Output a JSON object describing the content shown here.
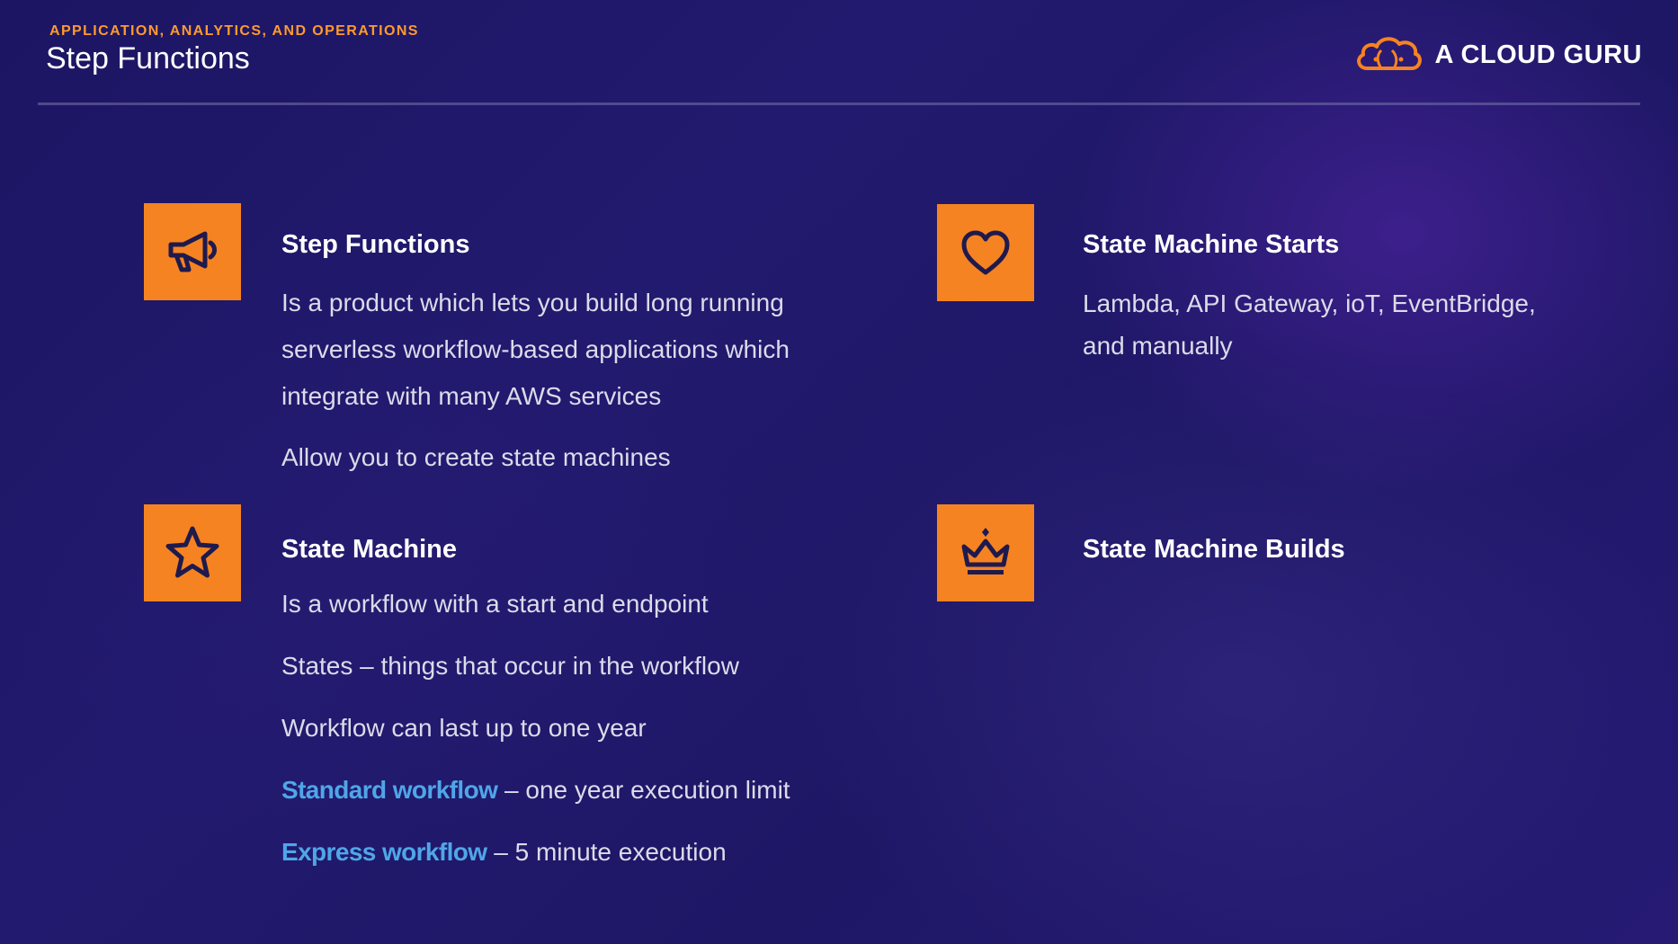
{
  "header": {
    "eyebrow": "APPLICATION, ANALYTICS, AND OPERATIONS",
    "title": "Step Functions",
    "brand_name": "A CLOUD GURU",
    "brand_icon": "cloud-logo-icon"
  },
  "colors": {
    "accent_orange": "#f68321",
    "eyebrow_orange": "#ff9a2e",
    "link_blue": "#4fa6e8",
    "background": "#1e1766"
  },
  "cards": {
    "step_functions": {
      "icon": "megaphone-icon",
      "heading": "Step Functions",
      "lines": [
        "Is a product which lets you build long running",
        "serverless workflow-based applications which",
        "integrate with many AWS services"
      ],
      "extra": "Allow you to create state machines"
    },
    "state_machine_starts": {
      "icon": "heart-icon",
      "heading": "State Machine Starts",
      "lines": [
        "Lambda, API Gateway, ioT, EventBridge,",
        "and manually"
      ]
    },
    "state_machine": {
      "icon": "star-icon",
      "heading": "State Machine",
      "items": [
        "Is a workflow with a start and endpoint",
        "States – things that occur in the workflow",
        "Workflow can last up to one year"
      ],
      "standard": {
        "label": "Standard workflow",
        "text": " – one year execution limit"
      },
      "express": {
        "label": "Express workflow",
        "text": " – 5 minute execution"
      }
    },
    "state_machine_builds": {
      "icon": "crown-icon",
      "heading": "State Machine Builds"
    }
  }
}
